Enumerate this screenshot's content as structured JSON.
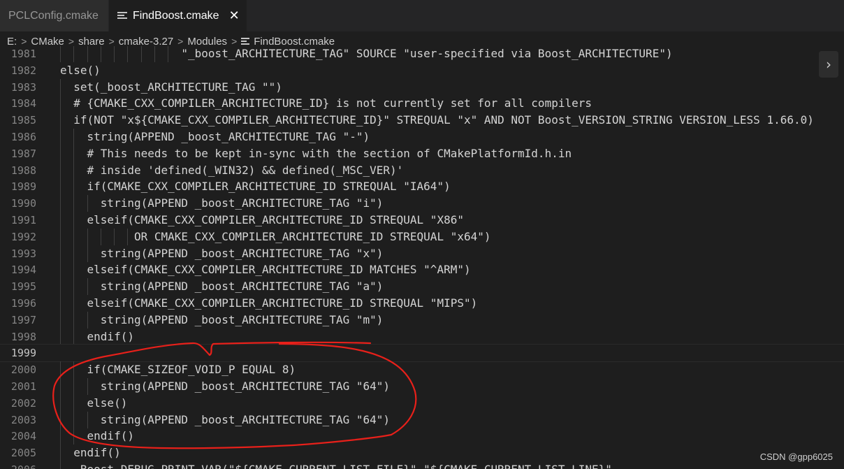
{
  "tabs": [
    {
      "label": "PCLConfig.cmake",
      "active": false
    },
    {
      "label": "FindBoost.cmake",
      "active": true,
      "close_glyph": "✕"
    }
  ],
  "breadcrumb": [
    "E:",
    "CMake",
    "share",
    "cmake-3.27",
    "Modules",
    "FindBoost.cmake"
  ],
  "breadcrumb_separator": ">",
  "editor": {
    "current_line": "1999",
    "lines": [
      {
        "num": "1981",
        "text": "                  \"_boost_ARCHITECTURE_TAG\" SOURCE \"user-specified via Boost_ARCHITECTURE\")"
      },
      {
        "num": "1982",
        "text": "else()"
      },
      {
        "num": "1983",
        "text": "  set(_boost_ARCHITECTURE_TAG \"\")"
      },
      {
        "num": "1984",
        "text": "  # {CMAKE_CXX_COMPILER_ARCHITECTURE_ID} is not currently set for all compilers"
      },
      {
        "num": "1985",
        "text": "  if(NOT \"x${CMAKE_CXX_COMPILER_ARCHITECTURE_ID}\" STREQUAL \"x\" AND NOT Boost_VERSION_STRING VERSION_LESS 1.66.0)"
      },
      {
        "num": "1986",
        "text": "    string(APPEND _boost_ARCHITECTURE_TAG \"-\")"
      },
      {
        "num": "1987",
        "text": "    # This needs to be kept in-sync with the section of CMakePlatformId.h.in"
      },
      {
        "num": "1988",
        "text": "    # inside 'defined(_WIN32) && defined(_MSC_VER)'"
      },
      {
        "num": "1989",
        "text": "    if(CMAKE_CXX_COMPILER_ARCHITECTURE_ID STREQUAL \"IA64\")"
      },
      {
        "num": "1990",
        "text": "      string(APPEND _boost_ARCHITECTURE_TAG \"i\")"
      },
      {
        "num": "1991",
        "text": "    elseif(CMAKE_CXX_COMPILER_ARCHITECTURE_ID STREQUAL \"X86\""
      },
      {
        "num": "1992",
        "text": "           OR CMAKE_CXX_COMPILER_ARCHITECTURE_ID STREQUAL \"x64\")"
      },
      {
        "num": "1993",
        "text": "      string(APPEND _boost_ARCHITECTURE_TAG \"x\")"
      },
      {
        "num": "1994",
        "text": "    elseif(CMAKE_CXX_COMPILER_ARCHITECTURE_ID MATCHES \"^ARM\")"
      },
      {
        "num": "1995",
        "text": "      string(APPEND _boost_ARCHITECTURE_TAG \"a\")"
      },
      {
        "num": "1996",
        "text": "    elseif(CMAKE_CXX_COMPILER_ARCHITECTURE_ID STREQUAL \"MIPS\")"
      },
      {
        "num": "1997",
        "text": "      string(APPEND _boost_ARCHITECTURE_TAG \"m\")"
      },
      {
        "num": "1998",
        "text": "    endif()"
      },
      {
        "num": "1999",
        "text": ""
      },
      {
        "num": "2000",
        "text": "    if(CMAKE_SIZEOF_VOID_P EQUAL 8)"
      },
      {
        "num": "2001",
        "text": "      string(APPEND _boost_ARCHITECTURE_TAG \"64\")"
      },
      {
        "num": "2002",
        "text": "    else()"
      },
      {
        "num": "2003",
        "text": "      string(APPEND _boost_ARCHITECTURE_TAG \"64\")"
      },
      {
        "num": "2004",
        "text": "    endif()"
      },
      {
        "num": "2005",
        "text": "  endif()"
      },
      {
        "num": "2006",
        "text": "  _Boost_DEBUG_PRINT_VAR(\"${CMAKE_CURRENT_LIST_FILE}\" \"${CMAKE_CURRENT_LIST_LINE}\""
      }
    ]
  },
  "side_button_glyph": "›",
  "watermark": "CSDN @gpp6025",
  "colors": {
    "background": "#1e1e1e",
    "annotation": "#e8201a"
  }
}
